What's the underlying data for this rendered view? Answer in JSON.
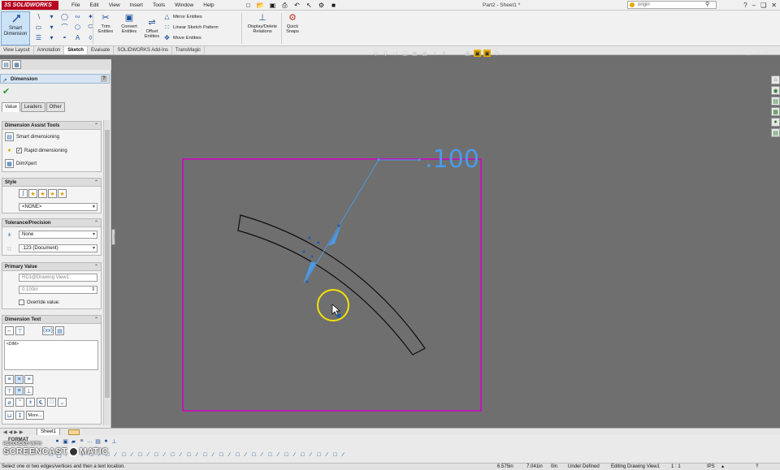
{
  "titlebar": {
    "logo_ds": "3S",
    "logo_text": "SOLIDWORKS",
    "menu": [
      "File",
      "Edit",
      "View",
      "Insert",
      "Tools",
      "Window",
      "Help"
    ],
    "document_title": "Part2 - Sheet1 *",
    "search_placeholder": "origin"
  },
  "ribbon": {
    "smart_dimension": "Smart Dimension",
    "trim": "Trim Entities",
    "convert": "Convert Entities",
    "offset": "Offset Entities",
    "mirror": "Mirror Entities",
    "linear_pattern": "Linear Sketch Pattern",
    "move": "Move Entities",
    "display_delete": "Display/Delete Relations",
    "quick_snaps": "Quick Snaps"
  },
  "tabs": [
    "View Layout",
    "Annotation",
    "Sketch",
    "Evaluate",
    "SOLIDWORKS Add-Ins",
    "TransMagic"
  ],
  "active_tab": "Sketch",
  "property_manager": {
    "title": "Dimension",
    "help": "?",
    "subtabs": [
      "Value",
      "Leaders",
      "Other"
    ],
    "assist": {
      "title": "Dimension Assist Tools",
      "items": [
        "Smart dimensioning",
        "Rapid dimensioning",
        "DimXpert"
      ]
    },
    "style": {
      "title": "Style",
      "dropdown": "<NONE>"
    },
    "tolerance": {
      "title": "Tolerance/Precision",
      "tolerance_value": "None",
      "precision_value": ".123 (Document)"
    },
    "primary": {
      "title": "Primary Value",
      "name": "RD1@Drawing View1",
      "value": "0.100in",
      "override": "Override value:"
    },
    "dimtext": {
      "title": "Dimension Text",
      "text": "<DIM>",
      "xx": "(xx)",
      "more": "More..."
    }
  },
  "drawing": {
    "dimension_value": ".100"
  },
  "sheet_tab": "Sheet1",
  "bottom": {
    "format": "FORMAT"
  },
  "watermark": {
    "line1": "RECORDED WITH",
    "line2a": "SCREENCAST",
    "line2b": "MATIC"
  },
  "status": {
    "message": "Select one or two edges/vertices and then a text location.",
    "x": "6.575in",
    "y": "7.041in",
    "z": "0in",
    "state": "Under Defined",
    "editing": "Editing Drawing View1",
    "scale": "1 : 1",
    "units": "IPS"
  },
  "colors": {
    "background": "#6f6f6f",
    "sheet_border": "#d400c8",
    "dimension": "#4a9be8",
    "cursor_highlight": "#f2e20a",
    "active_tab": "#ffffff"
  }
}
